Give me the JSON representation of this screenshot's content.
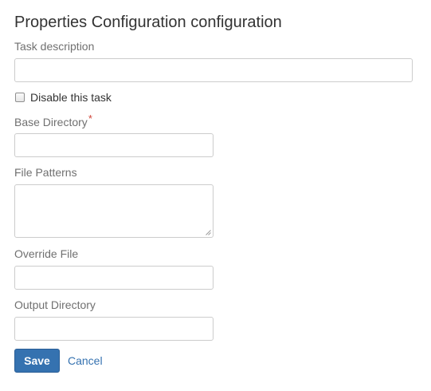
{
  "form": {
    "title": "Properties Configuration configuration",
    "task_description": {
      "label": "Task description",
      "value": "",
      "placeholder": ""
    },
    "disable_task": {
      "label": "Disable this task",
      "checked": false
    },
    "base_directory": {
      "label": "Base Directory",
      "required_marker": "*",
      "value": "",
      "placeholder": ""
    },
    "file_patterns": {
      "label": "File Patterns",
      "value": ""
    },
    "override_file": {
      "label": "Override File",
      "value": "",
      "placeholder": ""
    },
    "output_directory": {
      "label": "Output Directory",
      "value": "",
      "placeholder": ""
    },
    "actions": {
      "save_label": "Save",
      "cancel_label": "Cancel"
    },
    "colors": {
      "primary_button": "#3572b0",
      "link": "#3572b0",
      "required": "#d04437"
    }
  }
}
